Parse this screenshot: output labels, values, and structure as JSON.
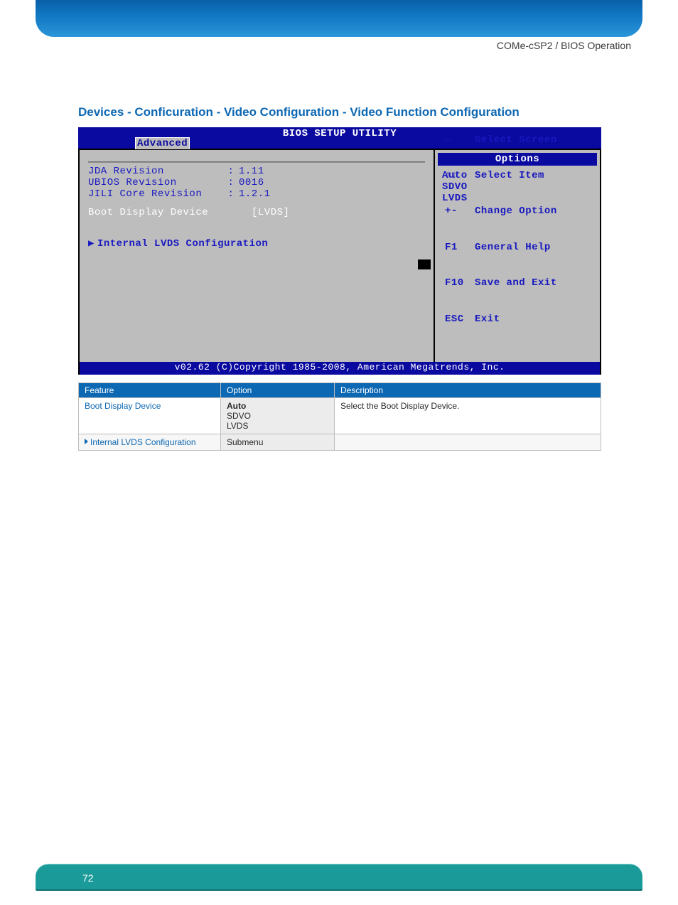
{
  "header": {
    "label": "COMe-cSP2 / BIOS Operation"
  },
  "section": {
    "heading": "Devices - Conficuration - Video Configuration - Video Function Configuration"
  },
  "bios": {
    "title": "BIOS SETUP UTILITY",
    "tab": "Advanced",
    "revisions": [
      {
        "label": "JDA Revision",
        "value": "1.11"
      },
      {
        "label": "UBIOS Revision",
        "value": "0016"
      },
      {
        "label": "JILI Core Revision",
        "value": "1.2.1"
      }
    ],
    "boot_label": "Boot Display Device",
    "boot_value": "[LVDS]",
    "submenu": "Internal LVDS Configuration",
    "options_header": "Options",
    "options": [
      "Auto",
      "SDVO",
      "LVDS"
    ],
    "help": [
      {
        "sym": "←",
        "text": "Select Screen"
      },
      {
        "sym": "↑↓",
        "text": "Select Item"
      },
      {
        "sym": "+-",
        "text": "Change Option"
      },
      {
        "sym": "F1",
        "text": "General Help"
      },
      {
        "sym": "F10",
        "text": "Save and Exit"
      },
      {
        "sym": "ESC",
        "text": "Exit"
      }
    ],
    "footer": "v02.62 (C)Copyright 1985-2008, American Megatrends, Inc."
  },
  "table": {
    "headers": {
      "feature": "Feature",
      "option": "Option",
      "description": "Description"
    },
    "rows": [
      {
        "feature": "Boot Display Device",
        "options": [
          "Auto",
          "SDVO",
          "LVDS"
        ],
        "description": "Select the Boot Display Device.",
        "link": true,
        "submenu": false
      },
      {
        "feature": "Internal LVDS Configuration",
        "options": [
          "Submenu"
        ],
        "description": "",
        "link": true,
        "submenu": true
      }
    ]
  },
  "page_number": "72"
}
